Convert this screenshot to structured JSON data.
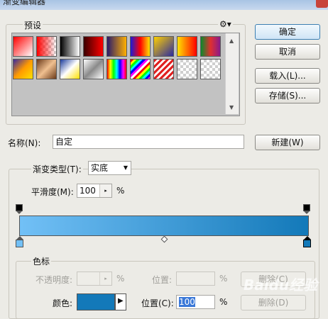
{
  "window": {
    "title": "渐变编辑器"
  },
  "presets": {
    "label": "预设",
    "menu_icon": "gear-icon",
    "row1": [
      "linear-gradient(135deg,#ff0000,#ffffff)",
      "checker-red",
      "linear-gradient(90deg,#000000,#ffffff)",
      "linear-gradient(90deg,#3a0000,#ff0000)",
      "linear-gradient(90deg,#2b1b6b,#ffb000)",
      "linear-gradient(90deg,#1b1bd6,#ff0000,#ffe600)",
      "linear-gradient(135deg,#ffd000,#2a2aa0)",
      "linear-gradient(90deg,#ffe000,#ff0000)",
      "linear-gradient(90deg,#0a8a2a,#e03030,#8a1a8a)"
    ],
    "row2": [
      "linear-gradient(135deg,#3a2aa0,#ff9a00,#ffe000)",
      "linear-gradient(135deg,#6b3a1a,#f0c090,#6b3a1a)",
      "linear-gradient(135deg,#1a3a9a,#ffffff,#ffe000)",
      "linear-gradient(135deg,#ffffff,#8a8a8a,#ffffff)",
      "linear-gradient(90deg,#ff0000,#ffff00,#00ff00,#00ffff,#0000ff,#ff00ff,#ff0000)",
      "rainbow-stripes",
      "red-stripes",
      "checker",
      "checker"
    ]
  },
  "buttons": {
    "ok": "确定",
    "cancel": "取消",
    "load": "载入(L)...",
    "save": "存储(S)...",
    "new": "新建(W)"
  },
  "name": {
    "label": "名称(N):",
    "value": "自定"
  },
  "gradient": {
    "type_label": "渐变类型(T):",
    "type_value": "实底",
    "smoothness_label": "平滑度(M):",
    "smoothness_value": "100",
    "percent": "%",
    "start_color": "#72c0f6",
    "end_color": "#1379b9"
  },
  "stops": {
    "label": "色标",
    "opacity_label": "不透明度:",
    "opacity_value": "",
    "opacity_percent": "%",
    "opacity_location_label": "位置:",
    "opacity_location_value": "",
    "opacity_location_percent": "%",
    "opacity_delete": "删除(C)",
    "color_label": "颜色:",
    "color_value": "#1379b9",
    "location_label": "位置(C):",
    "location_value": "100",
    "location_percent": "%",
    "delete": "删除(D)"
  },
  "watermark": "Baidu经验"
}
